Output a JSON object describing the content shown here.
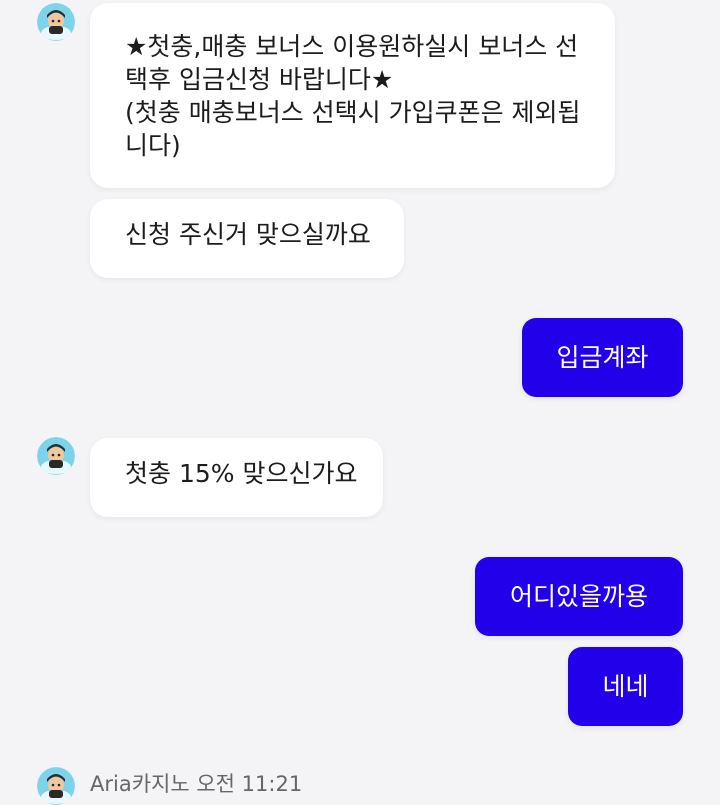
{
  "colors": {
    "background": "#f4f4f6",
    "incoming_bubble": "#ffffff",
    "outgoing_bubble": "#2200ea",
    "meta_text": "#666666"
  },
  "messages": [
    {
      "side": "incoming",
      "text": "★첫충,매충 보너스 이용원하실시 보너스 선\n택후 입금신청 바랍니다★\n(첫충 매충보너스 선택시 가입쿠폰은 제외됩\n니다)"
    },
    {
      "side": "incoming",
      "text": "신청 주신거 맞으실까요"
    },
    {
      "side": "outgoing",
      "text": "입금계좌"
    },
    {
      "side": "incoming",
      "text": "첫충 15% 맞으신가요"
    },
    {
      "side": "outgoing",
      "text": "어디있을까용"
    },
    {
      "side": "outgoing",
      "text": "네네"
    }
  ],
  "footer": {
    "sender_name": "Aria카지노",
    "time": "오전 11:21",
    "avatar_icon": "agent-avatar-icon"
  }
}
